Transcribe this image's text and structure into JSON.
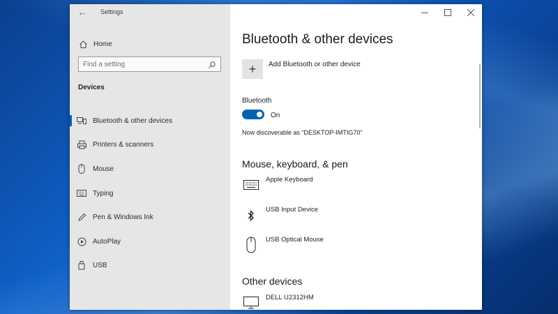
{
  "window": {
    "app_title": "Settings",
    "back_icon": "back-arrow-icon",
    "controls": [
      "minimize",
      "maximize",
      "close"
    ]
  },
  "sidebar": {
    "home_label": "Home",
    "search_placeholder": "Find a setting",
    "section_heading": "Devices",
    "items": [
      {
        "label": "Bluetooth & other devices",
        "icon": "bluetooth-devices-icon",
        "selected": true
      },
      {
        "label": "Printers & scanners",
        "icon": "printer-icon",
        "selected": false
      },
      {
        "label": "Mouse",
        "icon": "mouse-icon",
        "selected": false
      },
      {
        "label": "Typing",
        "icon": "keyboard-icon",
        "selected": false
      },
      {
        "label": "Pen & Windows Ink",
        "icon": "pen-icon",
        "selected": false
      },
      {
        "label": "AutoPlay",
        "icon": "autoplay-icon",
        "selected": false
      },
      {
        "label": "USB",
        "icon": "usb-icon",
        "selected": false
      }
    ]
  },
  "main": {
    "title": "Bluetooth & other devices",
    "add_device_label": "Add Bluetooth or other device",
    "bluetooth_label": "Bluetooth",
    "bluetooth_state": "On",
    "bluetooth_on": true,
    "discoverable_text": "Now discoverable as “DESKTOP-IMTIG70”",
    "groups": [
      {
        "heading": "Mouse, keyboard, & pen",
        "devices": [
          {
            "name": "Apple Keyboard",
            "icon": "keyboard-icon"
          },
          {
            "name": "USB Input Device",
            "icon": "bluetooth-icon"
          },
          {
            "name": "USB Optical Mouse",
            "icon": "mouse-icon"
          }
        ]
      },
      {
        "heading": "Other devices",
        "devices": [
          {
            "name": "DELL U2312HM",
            "icon": "monitor-icon"
          }
        ]
      }
    ]
  },
  "colors": {
    "accent": "#0063b1",
    "sidebar_bg": "#e6e6e6",
    "desktop_bg": "#0b4aa6"
  }
}
